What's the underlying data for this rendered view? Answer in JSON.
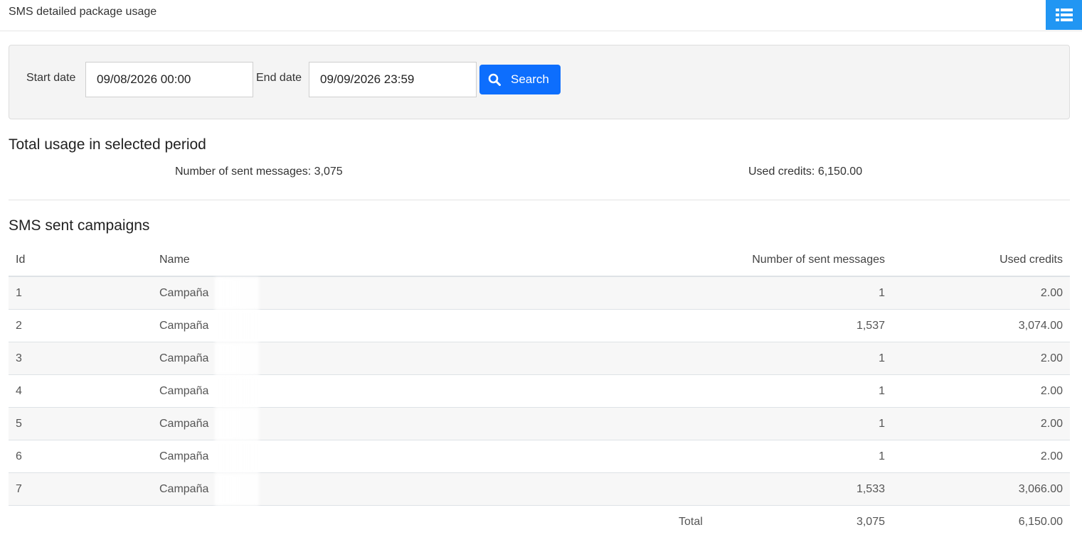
{
  "header": {
    "title": "SMS detailed package usage",
    "toggle_icon": "list-icon",
    "accent_color": "#2196f3"
  },
  "filters": {
    "start_label": "Start date",
    "start_value": "09/08/2026 00:00",
    "end_label": "End date",
    "end_value": "09/09/2026 23:59",
    "search_label": "Search",
    "search_icon": "search-icon",
    "button_color": "#0d6efd"
  },
  "usage": {
    "heading": "Total usage in selected period",
    "sent_messages": "Number of sent messages: 3,075",
    "used_credits": "Used credits: 6,150.00"
  },
  "campaigns": {
    "heading": "SMS sent campaigns",
    "columns": {
      "id": "Id",
      "name": "Name",
      "sent": "Number of sent messages",
      "credits": "Used credits"
    },
    "rows": [
      {
        "id": "1",
        "name": "Campaña",
        "sent": "1",
        "credits": "2.00"
      },
      {
        "id": "2",
        "name": "Campaña",
        "sent": "1,537",
        "credits": "3,074.00"
      },
      {
        "id": "3",
        "name": "Campaña",
        "sent": "1",
        "credits": "2.00"
      },
      {
        "id": "4",
        "name": "Campaña",
        "sent": "1",
        "credits": "2.00"
      },
      {
        "id": "5",
        "name": "Campaña",
        "sent": "1",
        "credits": "2.00"
      },
      {
        "id": "6",
        "name": "Campaña",
        "sent": "1",
        "credits": "2.00"
      },
      {
        "id": "7",
        "name": "Campaña",
        "sent": "1,533",
        "credits": "3,066.00"
      }
    ],
    "total": {
      "label": "Total",
      "sent": "3,075",
      "credits": "6,150.00"
    }
  }
}
